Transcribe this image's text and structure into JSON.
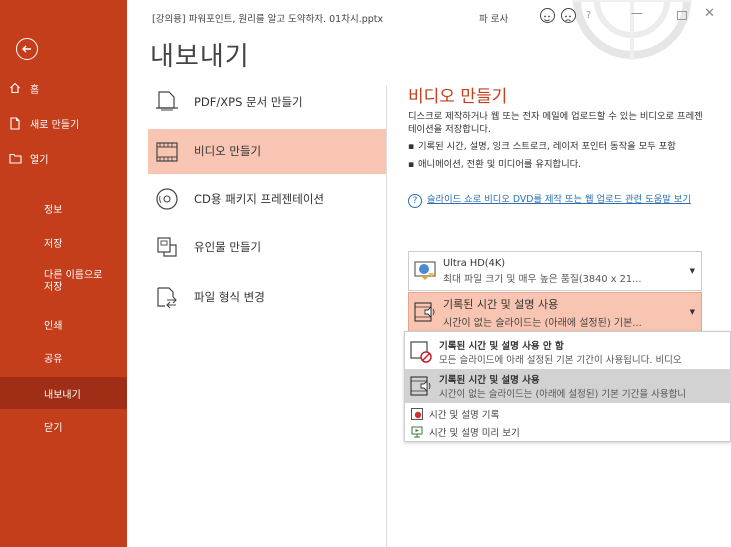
{
  "titlebar": {
    "document": "[강의용] 파워포인트, 원리를 알고 도약하자. 01차시.pptx",
    "user": "파 로사",
    "help": "?",
    "minimize": "—",
    "close": "✕"
  },
  "sidebar": {
    "back_icon": "back-arrow-icon",
    "items": [
      {
        "label": "홈",
        "icon": "home-icon"
      },
      {
        "label": "새로 만들기",
        "icon": "new-doc-icon"
      },
      {
        "label": "열기",
        "icon": "folder-icon"
      },
      {
        "label": "정보"
      },
      {
        "label": "저장"
      },
      {
        "label": "다른 이름으로 저장"
      },
      {
        "label": "인쇄"
      },
      {
        "label": "공유"
      },
      {
        "label": "내보내기"
      },
      {
        "label": "닫기"
      }
    ]
  },
  "main": {
    "title": "내보내기",
    "options": [
      {
        "label": "PDF/XPS 문서 만들기",
        "icon": "pdf-document-icon"
      },
      {
        "label": "비디오 만들기",
        "icon": "video-icon"
      },
      {
        "label": "CD용 패키지 프레젠테이션",
        "icon": "cd-icon"
      },
      {
        "label": "유인물 만들기",
        "icon": "handout-icon"
      },
      {
        "label": "파일 형식 변경",
        "icon": "file-type-icon"
      }
    ]
  },
  "panel": {
    "title": "비디오 만들기",
    "description": "디스크로 제작하거나 웹 또는 전자 메일에 업로드할 수 있는 비디오로 프레젠테이션을 저장합니다.",
    "bullets": [
      "기록된 시간, 설명, 잉크 스트로크, 레이저 포인터 동작을 모두 포함",
      "애니메이션, 전환 및 미디어를 유지합니다."
    ],
    "link": "슬라이드 쇼로 비디오 DVD를 제작 또는 웹 업로드 관련 도움말 보기",
    "quality": {
      "title": "Ultra HD(4K)",
      "subtitle": "최대 파일 크기 및 매우 높은 품질(3840 x 21..."
    },
    "timing": {
      "title": "기록된 시간 및 설명 사용",
      "subtitle": "시간이 없는 슬라이드는 (아래에 설정된) 기본..."
    },
    "menu": [
      {
        "title": "기록된 시간 및 설명 사용 안 함",
        "subtitle": "모든 슬라이드에 아래 설정된 기본 기간이 사용됩니다. 비디오"
      },
      {
        "title": "기록된 시간 및 설명 사용",
        "subtitle": "시간이 없는 슬라이드는 (아래에 설정된) 기본 기간을 사용합니"
      },
      {
        "title": "시간 및 설명 기록"
      },
      {
        "title": "시간 및 설명 미리 보기"
      }
    ]
  },
  "colors": {
    "accent": "#c43e1c",
    "sidebar_active": "#a02e16",
    "selection": "#f8c5b2",
    "link": "#2b6fb3"
  }
}
